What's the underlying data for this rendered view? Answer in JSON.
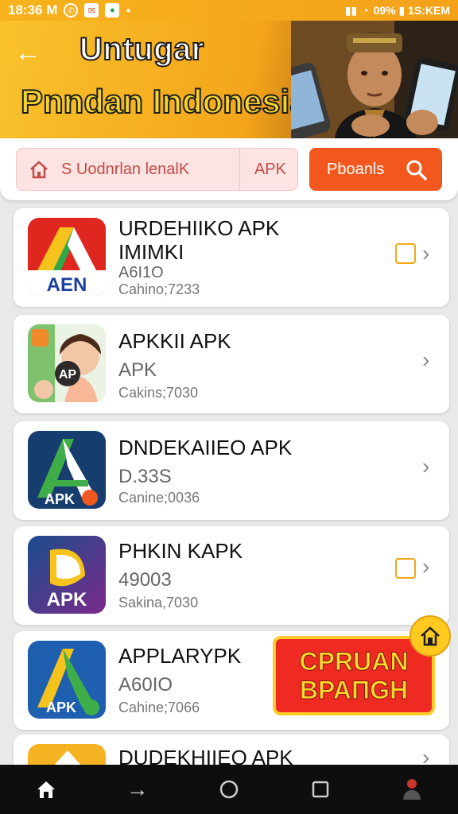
{
  "status_bar": {
    "time": "18:36 M",
    "right_text": "09% ▮ 1S:KEM"
  },
  "header": {
    "title_line1": "Untugar",
    "title_line2": "Pnndan Indonesia",
    "colors": {
      "banner": "#f4a51b",
      "title2": "#f6d52a"
    }
  },
  "search": {
    "placeholder": "S Uodnrlan lenalK",
    "tag": "APK",
    "button_label": "Pboanls"
  },
  "apps": [
    {
      "name_line1": "URDEHIIKO APK",
      "name_line2": "IMIMKI",
      "sub": "A6I1O",
      "meta": "Cahino;7233",
      "has_calendar": true
    },
    {
      "name_line1": "APKKII APK",
      "name_line2": "",
      "sub": "APK",
      "meta": "Cakins;7030",
      "has_calendar": false
    },
    {
      "name_line1": "DNDEKAIIEO APK",
      "name_line2": "",
      "sub": "D.33S",
      "meta": "Canine;0036",
      "has_calendar": false
    },
    {
      "name_line1": "PHKIN KAPK",
      "name_line2": "",
      "sub": "49003",
      "meta": "Sakina,7030",
      "has_calendar": true
    },
    {
      "name_line1": "APPLARYPK",
      "name_line2": "",
      "sub": "A60IO",
      "meta": "Cahine;7066",
      "has_calendar": false
    },
    {
      "name_line1": "DUDEKHIIEO APK",
      "name_line2": "",
      "sub": "",
      "meta": "",
      "has_calendar": false
    }
  ],
  "icon_texts": {
    "app1": "AEN",
    "app2": "AP",
    "app3": "APK",
    "app4": "APK",
    "app5": "APK"
  },
  "promo": {
    "line1": "CPRUAN",
    "line2": "BPAΠGH"
  },
  "navbar": {
    "items": [
      "home-icon",
      "forward-arrow-icon",
      "circle-home-icon",
      "square-recents-icon",
      "person-icon"
    ]
  }
}
